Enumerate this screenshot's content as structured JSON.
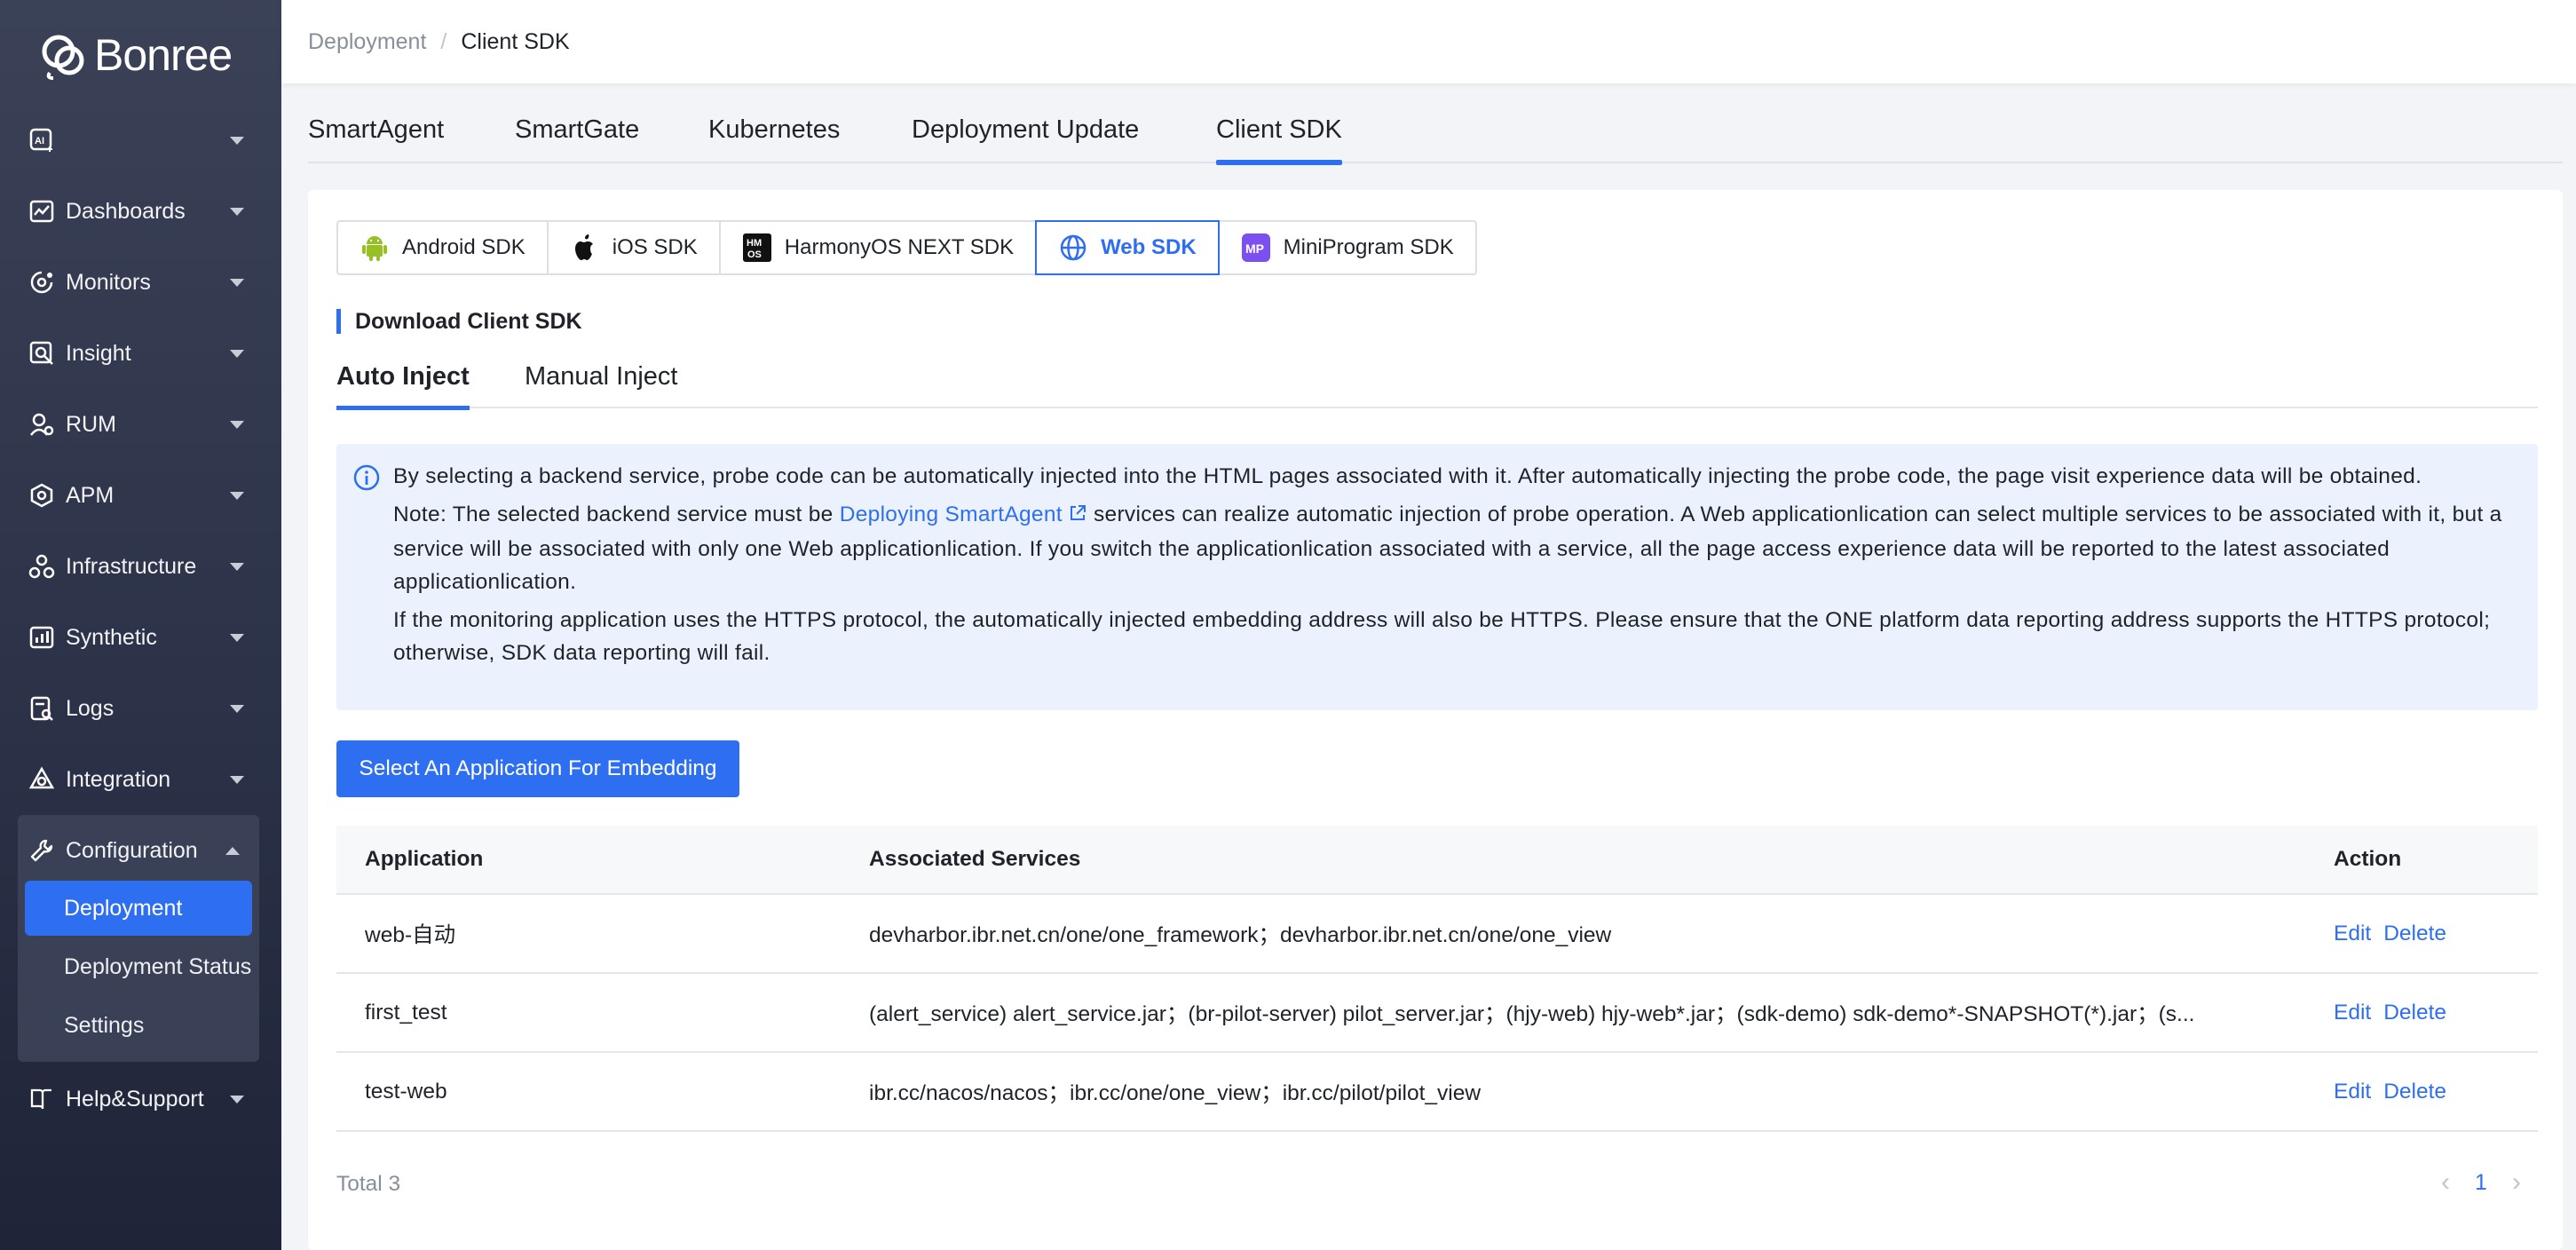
{
  "brand": {
    "name": "Bonree"
  },
  "sidebar": {
    "items": [
      {
        "label": "",
        "icon": "ai-icon"
      },
      {
        "label": "Dashboards",
        "icon": "chart-icon"
      },
      {
        "label": "Monitors",
        "icon": "monitor-icon"
      },
      {
        "label": "Insight",
        "icon": "insight-icon"
      },
      {
        "label": "RUM",
        "icon": "rum-icon"
      },
      {
        "label": "APM",
        "icon": "apm-icon"
      },
      {
        "label": "Infrastructure",
        "icon": "infrastructure-icon"
      },
      {
        "label": "Synthetic",
        "icon": "synthetic-icon"
      },
      {
        "label": "Logs",
        "icon": "logs-icon"
      },
      {
        "label": "Integration",
        "icon": "integration-icon"
      }
    ],
    "configuration": {
      "label": "Configuration",
      "sub_items": [
        "Deployment",
        "Deployment Status",
        "Settings"
      ]
    },
    "help": {
      "label": "Help&Support"
    }
  },
  "breadcrumb": {
    "parent": "Deployment",
    "sep": "/",
    "current": "Client SDK"
  },
  "main_tabs": [
    "SmartAgent",
    "SmartGate",
    "Kubernetes",
    "Deployment Update",
    "Client SDK"
  ],
  "sdk_tabs": [
    "Android SDK",
    "iOS SDK",
    "HarmonyOS NEXT SDK",
    "Web SDK",
    "MiniProgram SDK"
  ],
  "section_title": "Download Client SDK",
  "inject_tabs": [
    "Auto Inject",
    "Manual Inject"
  ],
  "info": {
    "p1": "By selecting a backend service, probe code can be automatically injected into the HTML pages associated with it. After automatically injecting the probe code, the page visit experience data will be obtained.",
    "p2_before": "Note: The selected backend service must be ",
    "p2_link": "Deploying SmartAgent",
    "p2_after": " services can realize automatic injection of probe operation. A Web applicationlication can select multiple services to be associated with it, but a service will be associated with only one Web applicationlication. If you switch the applicationlication associated with a service, all the page access experience data will be reported to the latest associated applicationlication.",
    "p3": "If the monitoring application uses the HTTPS protocol, the automatically injected embedding address will also be HTTPS. Please ensure that the ONE platform data reporting address supports the HTTPS protocol; otherwise, SDK data reporting will fail."
  },
  "embed_button": "Select An Application For Embedding",
  "table": {
    "headers": [
      "Application",
      "Associated Services",
      "Action"
    ],
    "rows": [
      {
        "app": "web-自动",
        "services": "devharbor.ibr.net.cn/one/one_framework；devharbor.ibr.net.cn/one/one_view"
      },
      {
        "app": "first_test",
        "services": "(alert_service) alert_service.jar；(br-pilot-server) pilot_server.jar；(hjy-web) hjy-web*.jar；(sdk-demo) sdk-demo*-SNAPSHOT(*).jar；(s..."
      },
      {
        "app": "test-web",
        "services": "ibr.cc/nacos/nacos；ibr.cc/one/one_view；ibr.cc/pilot/pilot_view"
      }
    ],
    "edit_label": "Edit",
    "delete_label": "Delete"
  },
  "footer": {
    "total": "Total 3",
    "page": "1",
    "prev": "‹",
    "next": "›"
  },
  "colors": {
    "primary": "#2e6ff2",
    "sidebar_bg": "#2c3248",
    "info_bg": "#ecf2fd"
  }
}
